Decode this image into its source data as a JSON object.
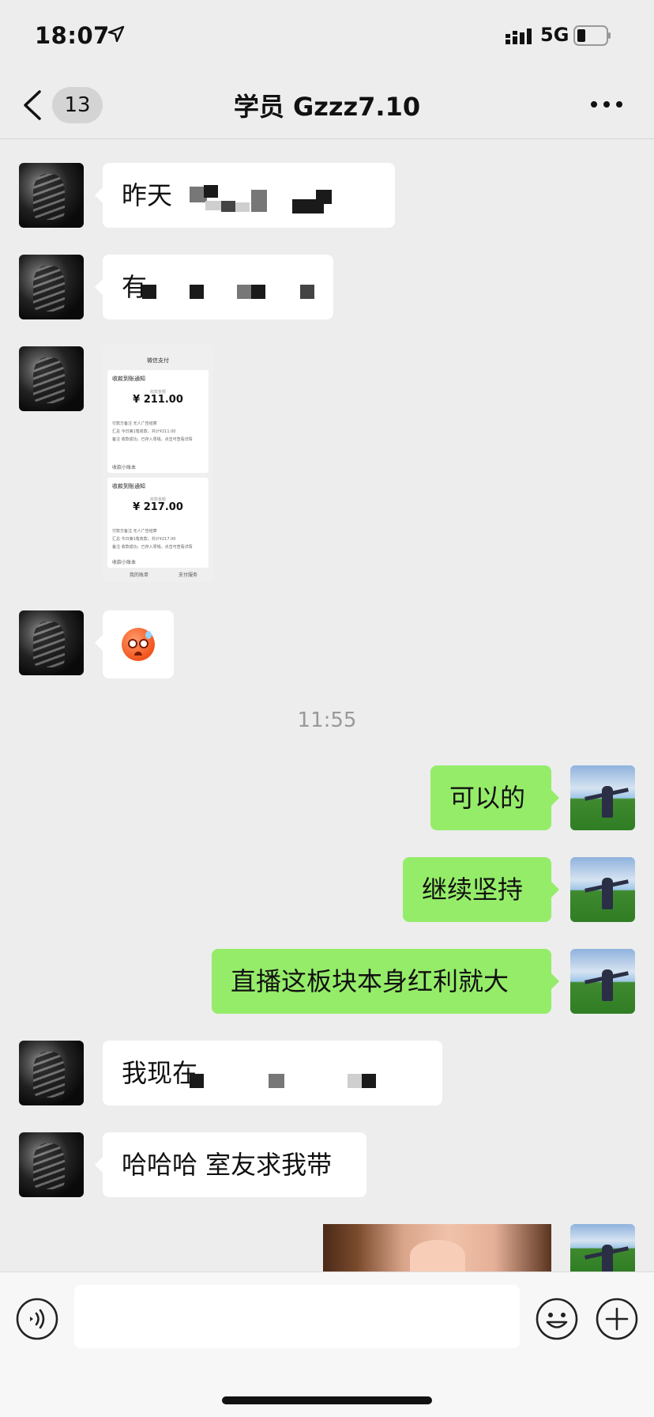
{
  "status_bar": {
    "time": "18:07",
    "network": "5G"
  },
  "nav": {
    "unread_count": "13",
    "title": "学员 Gzzz7.10"
  },
  "messages": {
    "m1": {
      "text": "昨天"
    },
    "m2": {
      "text": "有"
    },
    "m3_screenshot": {
      "header": "微信支付",
      "card1": {
        "title": "收款到账通知",
        "amount_label": "收款金额",
        "amount": "¥ 211.00",
        "line1": "付款方备注  无人广告结算",
        "line2": "汇总  今日第1笔收款，共计¥211.00",
        "line3": "备注  收款成功，已存入零钱。点击可查看详情",
        "footer": "收款小账本"
      },
      "card2": {
        "title": "收款到账通知",
        "amount_label": "收款金额",
        "amount": "¥ 217.00",
        "line1": "付款方备注  无人广告结算",
        "line2": "汇总  今日第1笔收款，共计¥217.00",
        "line3": "备注  收款成功，已存入零钱。点击可查看详情",
        "footer": "收款小账本"
      },
      "bottom_left": "我的账单",
      "bottom_right": "支付服务"
    },
    "timestamp": "11:55",
    "m5": {
      "text": "可以的"
    },
    "m6": {
      "text": "继续坚持"
    },
    "m7": {
      "text": "直播这板块本身红利就大"
    },
    "m8": {
      "text": "我现在"
    },
    "m9": {
      "text": "哈哈哈 室友求我带"
    }
  },
  "input_bar": {
    "placeholder": ""
  },
  "colors": {
    "outgoing_bubble": "#95ec69",
    "incoming_bubble": "#ffffff",
    "background": "#ededed"
  }
}
